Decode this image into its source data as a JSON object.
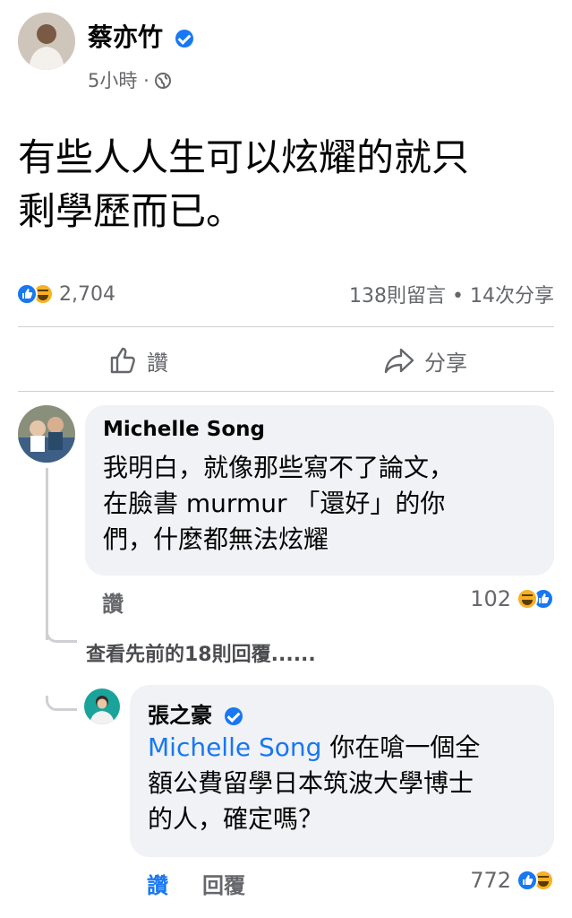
{
  "post": {
    "author": "蔡亦竹",
    "time": "5小時",
    "text_line1": "有些人人生可以炫耀的就只",
    "text_line2": "剩學歷而已。",
    "reaction_count": "2,704",
    "comments_shares": "138則留言 • 14次分享",
    "like_label": "讚",
    "share_label": "分享"
  },
  "comments": [
    {
      "author": "Michelle Song",
      "lines": [
        "我明白，就像那些寫不了論文，",
        "在臉書 murmur 「還好」的你",
        "們，什麼都無法炫耀"
      ],
      "like_label": "讚",
      "reaction_count": "102"
    }
  ],
  "view_previous": "查看先前的18則回覆......",
  "reply": {
    "author": "張之豪",
    "mention": "Michelle Song",
    "line1_rest": " 你在嗆一個全",
    "line2": "額公費留學日本筑波大學博士",
    "line3": "的人，確定嗎？",
    "like_label": "讚",
    "reply_label": "回覆",
    "reaction_count": "772"
  },
  "colors": {
    "accent": "#1877f2",
    "muted": "#65676b",
    "bubble": "#f0f2f5"
  }
}
